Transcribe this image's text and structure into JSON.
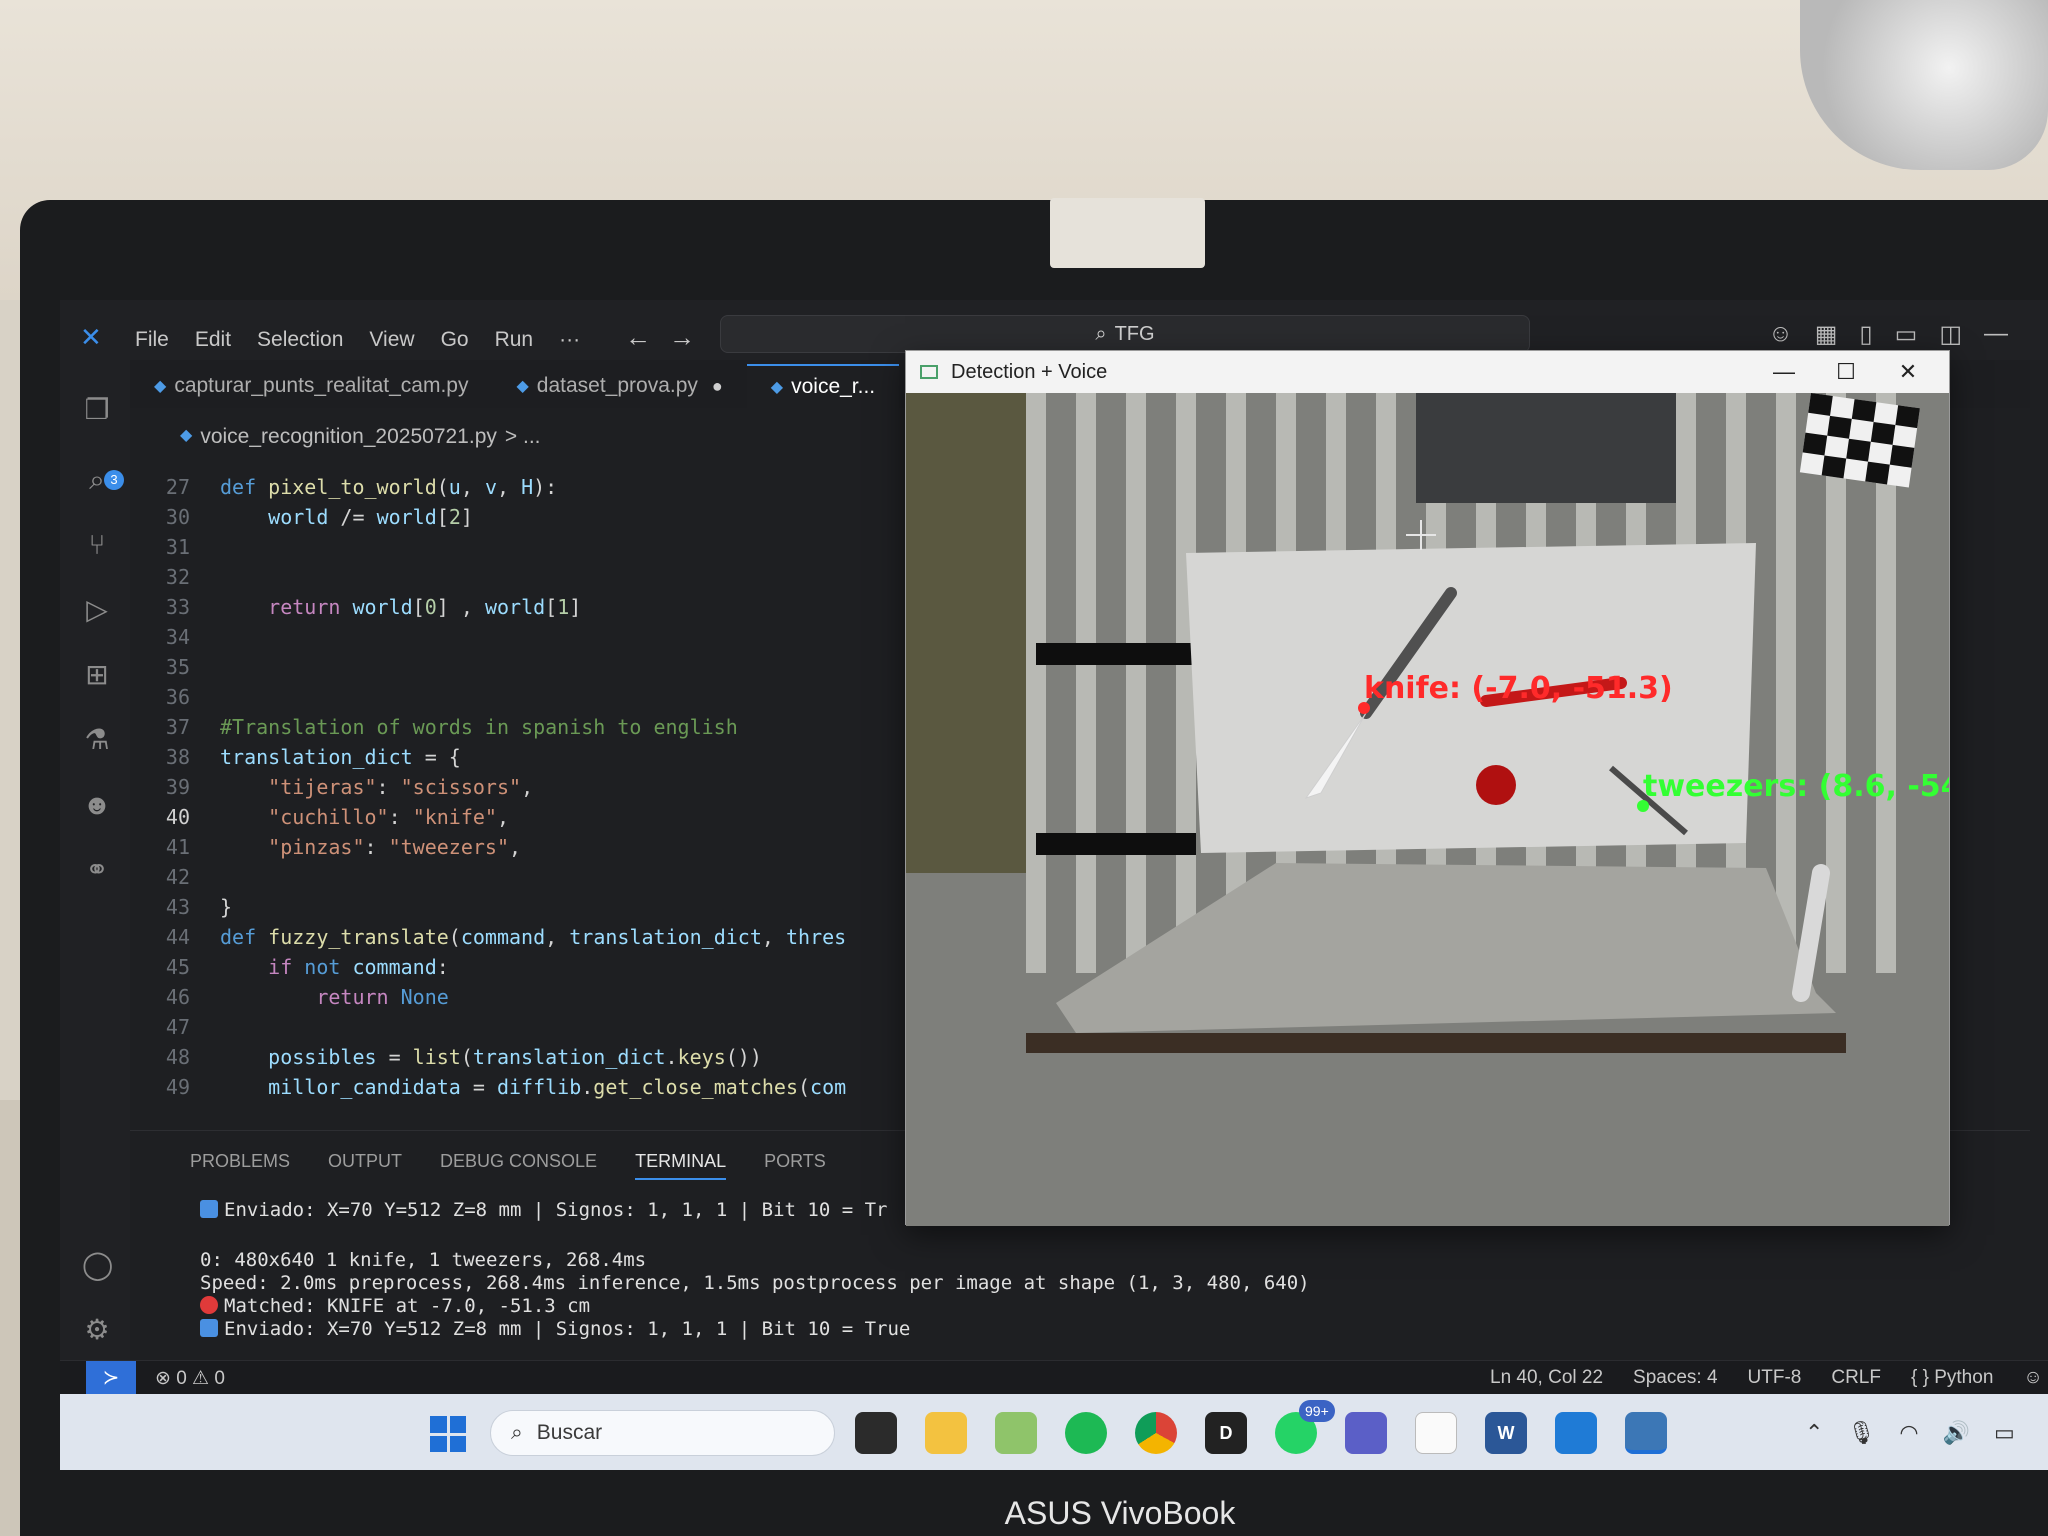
{
  "titlebar": {
    "menu": [
      "File",
      "Edit",
      "Selection",
      "View",
      "Go",
      "Run",
      "···"
    ],
    "search": "TFG"
  },
  "activity": {
    "badge": "3"
  },
  "tabs": [
    "capturar_punts_realitat_cam.py",
    "dataset_prova.py",
    "voice_r..."
  ],
  "breadcrumb": {
    "file": "voice_recognition_20250721.py",
    "rest": "> ..."
  },
  "editor": {
    "current_line": "40",
    "lines": [
      {
        "n": "27",
        "tokens": [
          [
            "kw",
            "def "
          ],
          [
            "fn",
            "pixel_to_world"
          ],
          [
            "code",
            "("
          ],
          [
            "var",
            "u"
          ],
          [
            "code",
            ", "
          ],
          [
            "var",
            "v"
          ],
          [
            "code",
            ", "
          ],
          [
            "var",
            "H"
          ],
          [
            "code",
            "):"
          ]
        ]
      },
      {
        "n": "30",
        "tokens": [
          [
            "code",
            "    "
          ],
          [
            "var",
            "world"
          ],
          [
            "code",
            " /= "
          ],
          [
            "var",
            "world"
          ],
          [
            "code",
            "["
          ],
          [
            "num",
            "2"
          ],
          [
            "code",
            "]"
          ]
        ]
      },
      {
        "n": "31",
        "tokens": []
      },
      {
        "n": "32",
        "tokens": []
      },
      {
        "n": "33",
        "tokens": [
          [
            "code",
            "    "
          ],
          [
            "kw2",
            "return "
          ],
          [
            "var",
            "world"
          ],
          [
            "code",
            "["
          ],
          [
            "num",
            "0"
          ],
          [
            "code",
            "] , "
          ],
          [
            "var",
            "world"
          ],
          [
            "code",
            "["
          ],
          [
            "num",
            "1"
          ],
          [
            "code",
            "]"
          ]
        ]
      },
      {
        "n": "34",
        "tokens": []
      },
      {
        "n": "35",
        "tokens": []
      },
      {
        "n": "36",
        "tokens": []
      },
      {
        "n": "37",
        "tokens": [
          [
            "com",
            "#Translation of words in spanish to english"
          ]
        ]
      },
      {
        "n": "38",
        "tokens": [
          [
            "var",
            "translation_dict"
          ],
          [
            "code",
            " = {"
          ]
        ]
      },
      {
        "n": "39",
        "tokens": [
          [
            "code",
            "    "
          ],
          [
            "str",
            "\"tijeras\""
          ],
          [
            "code",
            ": "
          ],
          [
            "str",
            "\"scissors\""
          ],
          [
            "code",
            ","
          ]
        ]
      },
      {
        "n": "40",
        "tokens": [
          [
            "code",
            "    "
          ],
          [
            "str",
            "\"cuchillo\""
          ],
          [
            "code",
            ": "
          ],
          [
            "str",
            "\"knife\""
          ],
          [
            "code",
            ","
          ]
        ]
      },
      {
        "n": "41",
        "tokens": [
          [
            "code",
            "    "
          ],
          [
            "str",
            "\"pinzas\""
          ],
          [
            "code",
            ": "
          ],
          [
            "str",
            "\"tweezers\""
          ],
          [
            "code",
            ","
          ]
        ]
      },
      {
        "n": "42",
        "tokens": []
      },
      {
        "n": "43",
        "tokens": [
          [
            "code",
            "}"
          ]
        ]
      },
      {
        "n": "44",
        "tokens": [
          [
            "kw",
            "def "
          ],
          [
            "fn",
            "fuzzy_translate"
          ],
          [
            "code",
            "("
          ],
          [
            "var",
            "command"
          ],
          [
            "code",
            ", "
          ],
          [
            "var",
            "translation_dict"
          ],
          [
            "code",
            ", "
          ],
          [
            "var",
            "thres"
          ]
        ]
      },
      {
        "n": "45",
        "tokens": [
          [
            "code",
            "    "
          ],
          [
            "kw2",
            "if "
          ],
          [
            "kw",
            "not "
          ],
          [
            "var",
            "command"
          ],
          [
            "code",
            ":"
          ]
        ]
      },
      {
        "n": "46",
        "tokens": [
          [
            "code",
            "        "
          ],
          [
            "kw2",
            "return "
          ],
          [
            "kw",
            "None"
          ]
        ]
      },
      {
        "n": "47",
        "tokens": []
      },
      {
        "n": "48",
        "tokens": [
          [
            "code",
            "    "
          ],
          [
            "var",
            "possibles"
          ],
          [
            "code",
            " = "
          ],
          [
            "fn",
            "list"
          ],
          [
            "code",
            "("
          ],
          [
            "var",
            "translation_dict"
          ],
          [
            "code",
            "."
          ],
          [
            "fn",
            "keys"
          ],
          [
            "code",
            "())"
          ]
        ]
      },
      {
        "n": "49",
        "tokens": [
          [
            "code",
            "    "
          ],
          [
            "var",
            "millor_candidata"
          ],
          [
            "code",
            " = "
          ],
          [
            "var",
            "difflib"
          ],
          [
            "code",
            "."
          ],
          [
            "fn",
            "get_close_matches"
          ],
          [
            "code",
            "("
          ],
          [
            "var",
            "com"
          ]
        ]
      }
    ]
  },
  "panel": {
    "tabs": [
      "PROBLEMS",
      "OUTPUT",
      "DEBUG CONSOLE",
      "TERMINAL",
      "PORTS"
    ],
    "active_tab": "TERMINAL",
    "terminal": [
      "Enviado: X=70 Y=512 Z=8 mm | Signos: 1, 1, 1 | Bit 10 = Tr",
      "0: 480x640 1 knife, 1 tweezers, 268.4ms",
      "Speed: 2.0ms preprocess, 268.4ms inference, 1.5ms postprocess per image at shape (1, 3, 480, 640)",
      "Matched: KNIFE at -7.0, -51.3 cm",
      "Enviado: X=70 Y=512 Z=8 mm | Signos: 1, 1, 1 | Bit 10 = True"
    ]
  },
  "statusbar": {
    "errors": "⊗ 0 ⚠ 0",
    "position": "Ln 40, Col 22",
    "spaces": "Spaces: 4",
    "encoding": "UTF-8",
    "eol": "CRLF",
    "language": "{ } Python"
  },
  "taskbar": {
    "search_placeholder": "Buscar",
    "whatsapp_badge": "99+",
    "discord_label": "D",
    "word_label": "W"
  },
  "detection": {
    "title": "Detection + Voice",
    "knife_label": "knife: (-7.0, -51.3)",
    "tweezers_label": "tweezers: (8.6, -54."
  },
  "brand": "ASUS VivoBook",
  "colors": {
    "accent": "#3b8eea",
    "knife_label": "#ff2a2a",
    "tweezers_label": "#33ff33"
  }
}
